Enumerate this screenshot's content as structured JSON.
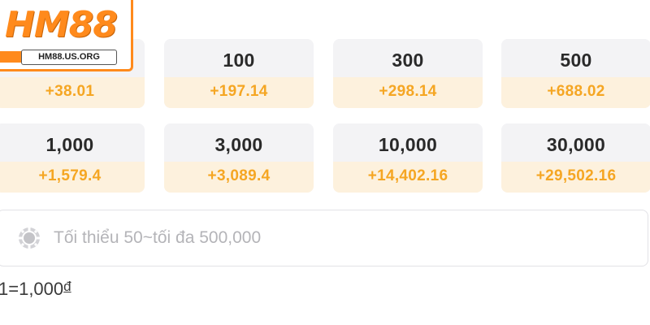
{
  "logo": {
    "text": "HM88",
    "url": "HM88.US.ORG",
    "color": "#ff8a1c"
  },
  "amounts": [
    {
      "amount": "",
      "bonus": "+38.01"
    },
    {
      "amount": "100",
      "bonus": "+197.14"
    },
    {
      "amount": "300",
      "bonus": "+298.14"
    },
    {
      "amount": "500",
      "bonus": "+688.02"
    },
    {
      "amount": "1,000",
      "bonus": "+1,579.4"
    },
    {
      "amount": "3,000",
      "bonus": "+3,089.4"
    },
    {
      "amount": "10,000",
      "bonus": "+14,402.16"
    },
    {
      "amount": "30,000",
      "bonus": "+29,502.16"
    }
  ],
  "input": {
    "placeholder": "Tối thiểu 50~tối đa 500,000",
    "value": "",
    "icon": "chip-icon"
  },
  "rate": {
    "text": "1=1,000",
    "currency": "đ"
  },
  "colors": {
    "bonus_text": "#f5a623",
    "bonus_bg": "#fdf1dd",
    "card_bg": "#f3f3f5"
  }
}
